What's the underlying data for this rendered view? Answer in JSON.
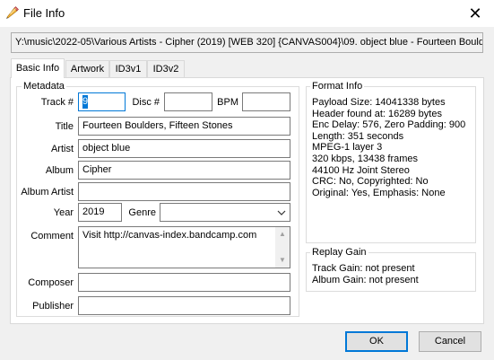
{
  "window": {
    "title": "File Info",
    "app_icon": "pencil-icon",
    "close_glyph": "✕"
  },
  "file_path": "Y:\\music\\2022-05\\Various Artists - Cipher (2019) [WEB 320] {CANVAS004}\\09. object blue - Fourteen Boulde",
  "tabs": [
    {
      "label": "Basic Info",
      "active": true
    },
    {
      "label": "Artwork",
      "active": false
    },
    {
      "label": "ID3v1",
      "active": false
    },
    {
      "label": "ID3v2",
      "active": false
    }
  ],
  "metadata": {
    "group_label": "Metadata",
    "track_label": "Track #",
    "track_value": "9",
    "disc_label": "Disc #",
    "disc_value": "",
    "bpm_label": "BPM",
    "bpm_value": "",
    "title_label": "Title",
    "title_value": "Fourteen Boulders, Fifteen Stones",
    "artist_label": "Artist",
    "artist_value": "object blue",
    "album_label": "Album",
    "album_value": "Cipher",
    "album_artist_label": "Album Artist",
    "album_artist_value": "",
    "year_label": "Year",
    "year_value": "2019",
    "genre_label": "Genre",
    "genre_value": "",
    "comment_label": "Comment",
    "comment_value": "Visit http://canvas-index.bandcamp.com",
    "composer_label": "Composer",
    "composer_value": "",
    "publisher_label": "Publisher",
    "publisher_value": ""
  },
  "format_info": {
    "group_label": "Format Info",
    "lines": [
      "Payload Size: 14041338 bytes",
      "Header found at: 16289 bytes",
      "Enc Delay: 576, Zero Padding: 900",
      "Length: 351 seconds",
      "MPEG-1 layer 3",
      "320 kbps, 13438 frames",
      "44100 Hz Joint Stereo",
      "CRC: No, Copyrighted: No",
      "Original: Yes, Emphasis: None"
    ]
  },
  "replay_gain": {
    "group_label": "Replay Gain",
    "lines": [
      "Track Gain: not present",
      "Album Gain: not present"
    ]
  },
  "buttons": {
    "ok": "OK",
    "cancel": "Cancel"
  },
  "colors": {
    "accent": "#0078d7",
    "window_bg": "#f0f0f0",
    "panel_bg": "#ffffff"
  }
}
